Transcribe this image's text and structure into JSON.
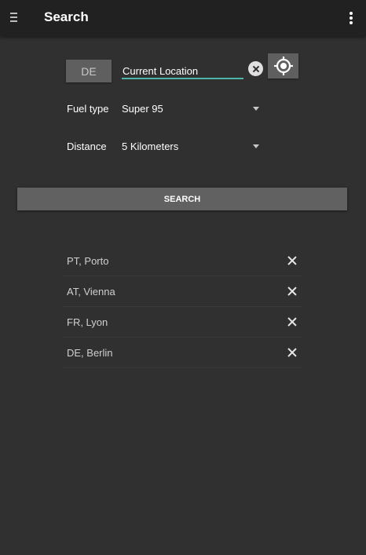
{
  "app_bar": {
    "title": "Search",
    "menu_icon": "hamburger-menu-icon",
    "overflow_icon": "more-vert-icon",
    "background": "#212121"
  },
  "search_form": {
    "country_code": "DE",
    "location_value": "Current Location",
    "clear_icon": "clear-circle-icon",
    "gps_icon": "my-location-icon",
    "accent_color": "#4db6ac",
    "fuel_type": {
      "label": "Fuel type",
      "selected": "Super 95"
    },
    "distance": {
      "label": "Distance",
      "selected": "5 Kilometers"
    },
    "search_button_label": "SEARCH"
  },
  "recent_searches": [
    {
      "label": "PT, Porto"
    },
    {
      "label": "AT, Vienna"
    },
    {
      "label": "FR, Lyon"
    },
    {
      "label": "DE, Berlin"
    }
  ],
  "colors": {
    "background": "#303030",
    "button": "#616161"
  }
}
